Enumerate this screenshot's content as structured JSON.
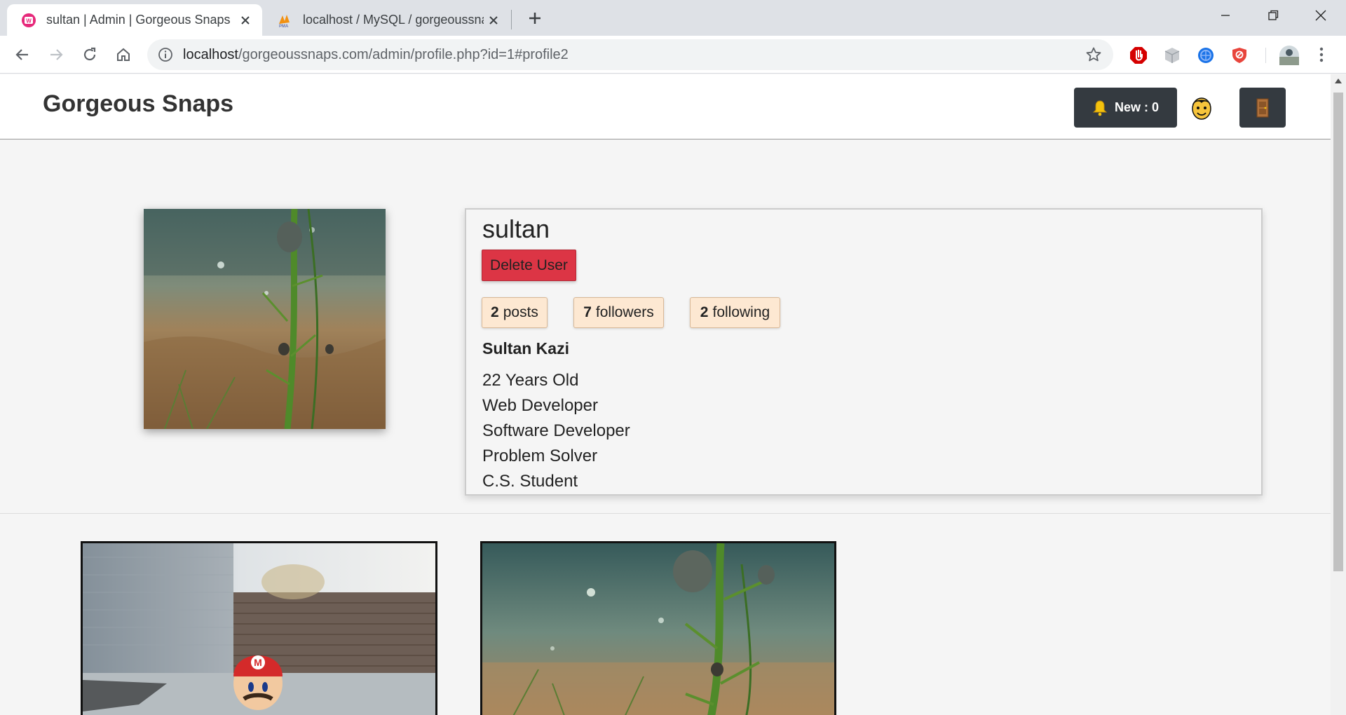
{
  "browser": {
    "tabs": [
      {
        "title": "sultan | Admin | Gorgeous Snaps",
        "active": true,
        "icon": "wamp-icon"
      },
      {
        "title": "localhost / MySQL / gorgeoussnaps",
        "active": false,
        "icon": "phpmyadmin-icon"
      }
    ],
    "url_host": "localhost",
    "url_path": "/gorgeoussnaps.com/admin/profile.php?id=1#profile2"
  },
  "header": {
    "brand": "Gorgeous Snaps",
    "notifications_label": "New : 0"
  },
  "profile": {
    "username": "sultan",
    "delete_label": "Delete User",
    "stats": {
      "posts_count": "2",
      "posts_label": "posts",
      "followers_count": "7",
      "followers_label": "followers",
      "following_count": "2",
      "following_label": "following"
    },
    "full_name": "Sultan Kazi",
    "bio": [
      "22 Years Old",
      "Web Developer",
      "Software Developer",
      "Problem Solver",
      "C.S. Student"
    ]
  },
  "colors": {
    "danger": "#dc3545",
    "dark_button": "#343a40",
    "stat_bg": "#fde8d2"
  }
}
